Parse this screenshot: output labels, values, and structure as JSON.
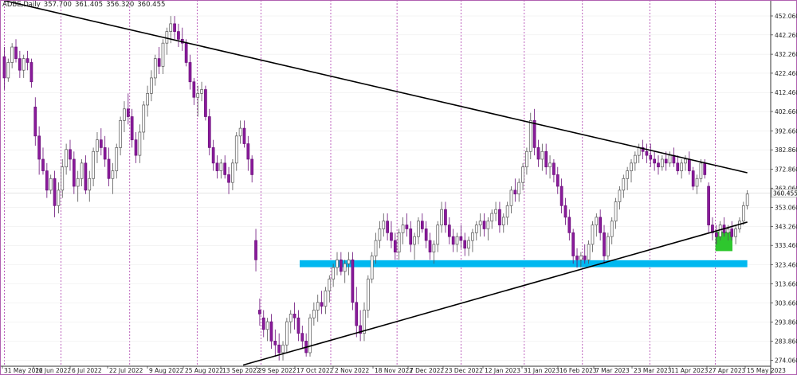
{
  "chart_data": {
    "type": "candlestick",
    "symbol_label": "ADBE,Daily",
    "ohlc_header": [
      "357.700",
      "361.405",
      "356.320",
      "360.455"
    ],
    "last_price": 360.455,
    "last_price_label": "360.455",
    "y_ticks": [
      "452.060",
      "442.260",
      "432.260",
      "422.460",
      "412.460",
      "402.660",
      "392.660",
      "382.860",
      "372.860",
      "363.060",
      "353.060",
      "343.260",
      "333.460",
      "323.460",
      "313.660",
      "303.660",
      "293.860",
      "283.860",
      "274.060"
    ],
    "y_range": [
      271,
      457
    ],
    "x_labels": [
      "31 May 2022",
      "16 Jun 2022",
      "6 Jul 2022",
      "22 Jul 2022",
      "9 Aug 2022",
      "25 Aug 2022",
      "13 Sep 2022",
      "29 Sep 2022",
      "17 Oct 2022",
      "2 Nov 2022",
      "18 Nov 2022",
      "7 Dec 2022",
      "23 Dec 2022",
      "12 Jan 2023",
      "31 Jan 2023",
      "16 Feb 2023",
      "7 Mar 2023",
      "23 Mar 2023",
      "11 Apr 2023",
      "27 Apr 2023",
      "15 May 2023"
    ],
    "month_separators": [
      "Jun 2022",
      "Jul 2022",
      "Aug 2022",
      "Sep 2022",
      "Oct 2022",
      "Nov 2022",
      "Dec 2022",
      "Jan 2023",
      "Feb 2023",
      "Mar 2023",
      "Apr 2023",
      "May 2023"
    ],
    "trendlines": [
      {
        "name": "descending-resistance",
        "points": [
          [
            "1 Jun 2022",
            460.0
          ],
          [
            "16 May 2023",
            371.0
          ]
        ]
      },
      {
        "name": "ascending-support",
        "points": [
          [
            "23 Sep 2022",
            271.6
          ],
          [
            "16 May 2023",
            345.5
          ]
        ]
      }
    ],
    "zones": [
      {
        "name": "support-zone",
        "from": "19 Oct 2022",
        "to": "16 May 2023",
        "low": 322.2,
        "high": 325.8
      },
      {
        "name": "demand-zone",
        "from": "1 May 2023",
        "to": "9 May 2023",
        "low": 330.5,
        "high": 340.6
      }
    ],
    "candles_hint": "[date index, open, high, low, close] approximated from the chart",
    "candles": [
      [
        0,
        431,
        436,
        414,
        420
      ],
      [
        1,
        420,
        430,
        418,
        428
      ],
      [
        2,
        428,
        438,
        425,
        436
      ],
      [
        3,
        436,
        440,
        428,
        430
      ],
      [
        4,
        430,
        434,
        420,
        424
      ],
      [
        5,
        424,
        432,
        420,
        430
      ],
      [
        6,
        430,
        434,
        424,
        428
      ],
      [
        7,
        428,
        430,
        415,
        418
      ],
      [
        8,
        405,
        410,
        385,
        390
      ],
      [
        9,
        390,
        395,
        370,
        378
      ],
      [
        10,
        378,
        384,
        370,
        372
      ],
      [
        11,
        372,
        376,
        358,
        362
      ],
      [
        12,
        362,
        370,
        360,
        368
      ],
      [
        13,
        368,
        372,
        348,
        354
      ],
      [
        14,
        354,
        366,
        350,
        362
      ],
      [
        15,
        362,
        378,
        358,
        374
      ],
      [
        16,
        374,
        386,
        370,
        383
      ],
      [
        17,
        383,
        388,
        372,
        378
      ],
      [
        18,
        378,
        382,
        360,
        364
      ],
      [
        19,
        364,
        372,
        356,
        368
      ],
      [
        20,
        368,
        378,
        364,
        376
      ],
      [
        21,
        376,
        380,
        360,
        362
      ],
      [
        22,
        362,
        372,
        356,
        368
      ],
      [
        23,
        368,
        384,
        364,
        382
      ],
      [
        24,
        382,
        392,
        376,
        388
      ],
      [
        25,
        388,
        394,
        380,
        384
      ],
      [
        26,
        384,
        390,
        374,
        378
      ],
      [
        27,
        378,
        384,
        364,
        368
      ],
      [
        28,
        368,
        376,
        360,
        372
      ],
      [
        29,
        372,
        386,
        368,
        384
      ],
      [
        30,
        384,
        400,
        380,
        398
      ],
      [
        31,
        398,
        408,
        392,
        404
      ],
      [
        32,
        404,
        412,
        396,
        400
      ],
      [
        33,
        400,
        404,
        384,
        388
      ],
      [
        34,
        388,
        392,
        376,
        380
      ],
      [
        35,
        380,
        396,
        376,
        392
      ],
      [
        36,
        392,
        408,
        388,
        406
      ],
      [
        37,
        406,
        416,
        400,
        412
      ],
      [
        38,
        412,
        424,
        408,
        420
      ],
      [
        39,
        420,
        432,
        416,
        430
      ],
      [
        40,
        430,
        436,
        422,
        426
      ],
      [
        41,
        426,
        440,
        422,
        438
      ],
      [
        42,
        438,
        446,
        432,
        444
      ],
      [
        43,
        444,
        452,
        438,
        448
      ],
      [
        44,
        448,
        452,
        440,
        444
      ],
      [
        45,
        444,
        448,
        436,
        440
      ],
      [
        46,
        440,
        446,
        434,
        438
      ],
      [
        47,
        438,
        440,
        426,
        428
      ],
      [
        48,
        428,
        432,
        414,
        418
      ],
      [
        49,
        418,
        420,
        406,
        410
      ],
      [
        50,
        410,
        416,
        400,
        412
      ],
      [
        51,
        412,
        418,
        408,
        414
      ],
      [
        52,
        414,
        416,
        398,
        400
      ],
      [
        53,
        400,
        404,
        380,
        384
      ],
      [
        54,
        384,
        388,
        372,
        376
      ],
      [
        55,
        376,
        380,
        368,
        372
      ],
      [
        56,
        372,
        378,
        368,
        376
      ],
      [
        57,
        376,
        380,
        368,
        370
      ],
      [
        58,
        370,
        374,
        360,
        366
      ],
      [
        59,
        366,
        378,
        362,
        376
      ],
      [
        60,
        376,
        392,
        372,
        390
      ],
      [
        61,
        390,
        398,
        386,
        394
      ],
      [
        62,
        394,
        398,
        384,
        386
      ],
      [
        63,
        386,
        390,
        372,
        378
      ],
      [
        64,
        378,
        380,
        366,
        370
      ],
      [
        65,
        336,
        342,
        320,
        326
      ],
      [
        66,
        300,
        306,
        292,
        298
      ],
      [
        67,
        296,
        300,
        286,
        290
      ],
      [
        68,
        290,
        296,
        284,
        294
      ],
      [
        69,
        294,
        298,
        280,
        284
      ],
      [
        70,
        284,
        290,
        276,
        282
      ],
      [
        71,
        282,
        288,
        274,
        278
      ],
      [
        72,
        278,
        284,
        274,
        282
      ],
      [
        73,
        282,
        296,
        278,
        294
      ],
      [
        74,
        294,
        300,
        288,
        298
      ],
      [
        75,
        298,
        304,
        290,
        296
      ],
      [
        76,
        296,
        300,
        284,
        288
      ],
      [
        77,
        288,
        292,
        280,
        284
      ],
      [
        78,
        284,
        288,
        276,
        278
      ],
      [
        79,
        278,
        298,
        276,
        296
      ],
      [
        80,
        296,
        304,
        292,
        300
      ],
      [
        81,
        300,
        308,
        294,
        304
      ],
      [
        82,
        304,
        310,
        298,
        302
      ],
      [
        83,
        302,
        312,
        298,
        310
      ],
      [
        84,
        310,
        318,
        304,
        316
      ],
      [
        85,
        316,
        324,
        312,
        322
      ],
      [
        86,
        322,
        330,
        318,
        326
      ],
      [
        87,
        326,
        330,
        318,
        320
      ],
      [
        88,
        320,
        326,
        314,
        324
      ],
      [
        89,
        324,
        330,
        318,
        326
      ],
      [
        90,
        326,
        330,
        300,
        304
      ],
      [
        91,
        304,
        312,
        286,
        292
      ],
      [
        92,
        292,
        300,
        284,
        288
      ],
      [
        93,
        288,
        304,
        284,
        300
      ],
      [
        94,
        300,
        318,
        296,
        316
      ],
      [
        95,
        316,
        330,
        314,
        328
      ],
      [
        96,
        328,
        340,
        324,
        336
      ],
      [
        97,
        336,
        346,
        332,
        342
      ],
      [
        98,
        342,
        350,
        338,
        346
      ],
      [
        99,
        346,
        350,
        336,
        340
      ],
      [
        100,
        340,
        346,
        332,
        336
      ],
      [
        101,
        336,
        340,
        326,
        330
      ],
      [
        102,
        330,
        342,
        326,
        340
      ],
      [
        103,
        340,
        348,
        334,
        344
      ],
      [
        104,
        344,
        350,
        338,
        342
      ],
      [
        105,
        342,
        346,
        330,
        334
      ],
      [
        106,
        334,
        340,
        326,
        338
      ],
      [
        107,
        338,
        348,
        334,
        346
      ],
      [
        108,
        346,
        350,
        340,
        342
      ],
      [
        109,
        342,
        346,
        332,
        336
      ],
      [
        110,
        336,
        340,
        326,
        330
      ],
      [
        111,
        330,
        336,
        324,
        334
      ],
      [
        112,
        334,
        346,
        330,
        344
      ],
      [
        113,
        344,
        356,
        340,
        352
      ],
      [
        114,
        352,
        356,
        340,
        344
      ],
      [
        115,
        344,
        348,
        334,
        338
      ],
      [
        116,
        338,
        342,
        330,
        334
      ],
      [
        117,
        334,
        340,
        330,
        338
      ],
      [
        118,
        338,
        344,
        332,
        336
      ],
      [
        119,
        336,
        340,
        328,
        332
      ],
      [
        120,
        332,
        338,
        328,
        336
      ],
      [
        121,
        336,
        342,
        330,
        340
      ],
      [
        122,
        340,
        346,
        336,
        344
      ],
      [
        123,
        344,
        350,
        338,
        346
      ],
      [
        124,
        346,
        350,
        338,
        342
      ],
      [
        125,
        342,
        348,
        336,
        346
      ],
      [
        126,
        346,
        352,
        342,
        350
      ],
      [
        127,
        350,
        356,
        346,
        352
      ],
      [
        128,
        352,
        356,
        340,
        344
      ],
      [
        129,
        344,
        350,
        340,
        348
      ],
      [
        130,
        348,
        356,
        344,
        354
      ],
      [
        131,
        354,
        364,
        350,
        362
      ],
      [
        132,
        362,
        368,
        356,
        360
      ],
      [
        133,
        360,
        368,
        356,
        366
      ],
      [
        134,
        366,
        376,
        362,
        374
      ],
      [
        135,
        374,
        384,
        370,
        382
      ],
      [
        136,
        382,
        402,
        378,
        398
      ],
      [
        137,
        398,
        404,
        380,
        384
      ],
      [
        138,
        384,
        388,
        374,
        378
      ],
      [
        139,
        378,
        386,
        372,
        382
      ],
      [
        140,
        382,
        386,
        370,
        374
      ],
      [
        141,
        374,
        380,
        368,
        376
      ],
      [
        142,
        376,
        378,
        366,
        370
      ],
      [
        143,
        370,
        374,
        360,
        364
      ],
      [
        144,
        364,
        368,
        350,
        354
      ],
      [
        145,
        354,
        358,
        344,
        348
      ],
      [
        146,
        348,
        352,
        336,
        340
      ],
      [
        147,
        340,
        342,
        324,
        328
      ],
      [
        148,
        328,
        332,
        322,
        326
      ],
      [
        149,
        326,
        330,
        322,
        328
      ],
      [
        150,
        328,
        334,
        324,
        326
      ],
      [
        151,
        326,
        336,
        324,
        334
      ],
      [
        152,
        334,
        346,
        330,
        344
      ],
      [
        153,
        344,
        350,
        338,
        348
      ],
      [
        154,
        348,
        352,
        336,
        340
      ],
      [
        155,
        340,
        344,
        324,
        328
      ],
      [
        156,
        328,
        340,
        326,
        338
      ],
      [
        157,
        338,
        348,
        334,
        346
      ],
      [
        158,
        346,
        358,
        342,
        356
      ],
      [
        159,
        356,
        364,
        352,
        362
      ],
      [
        160,
        362,
        370,
        358,
        368
      ],
      [
        161,
        368,
        374,
        362,
        372
      ],
      [
        162,
        372,
        378,
        366,
        376
      ],
      [
        163,
        376,
        382,
        372,
        380
      ],
      [
        164,
        380,
        386,
        376,
        384
      ],
      [
        165,
        384,
        388,
        378,
        382
      ],
      [
        166,
        382,
        386,
        376,
        380
      ],
      [
        167,
        380,
        386,
        374,
        378
      ],
      [
        168,
        378,
        382,
        372,
        376
      ],
      [
        169,
        376,
        380,
        370,
        374
      ],
      [
        170,
        374,
        380,
        372,
        378
      ],
      [
        171,
        378,
        382,
        372,
        376
      ],
      [
        172,
        376,
        382,
        374,
        380
      ],
      [
        173,
        380,
        384,
        374,
        376
      ],
      [
        174,
        376,
        380,
        370,
        372
      ],
      [
        175,
        372,
        378,
        368,
        376
      ],
      [
        176,
        376,
        380,
        372,
        378
      ],
      [
        177,
        378,
        382,
        370,
        372
      ],
      [
        178,
        372,
        374,
        362,
        364
      ],
      [
        179,
        364,
        370,
        360,
        368
      ],
      [
        180,
        368,
        378,
        366,
        376
      ],
      [
        181,
        376,
        378,
        368,
        370
      ],
      [
        182,
        364,
        366,
        340,
        344
      ],
      [
        183,
        344,
        348,
        336,
        340
      ],
      [
        184,
        340,
        344,
        334,
        338
      ],
      [
        185,
        338,
        346,
        336,
        344
      ],
      [
        186,
        344,
        348,
        338,
        340
      ],
      [
        187,
        340,
        344,
        336,
        342
      ],
      [
        188,
        342,
        346,
        336,
        338
      ],
      [
        189,
        338,
        344,
        334,
        342
      ],
      [
        190,
        342,
        348,
        340,
        346
      ],
      [
        191,
        346,
        356,
        344,
        354
      ],
      [
        192,
        354,
        362,
        352,
        360
      ]
    ]
  }
}
